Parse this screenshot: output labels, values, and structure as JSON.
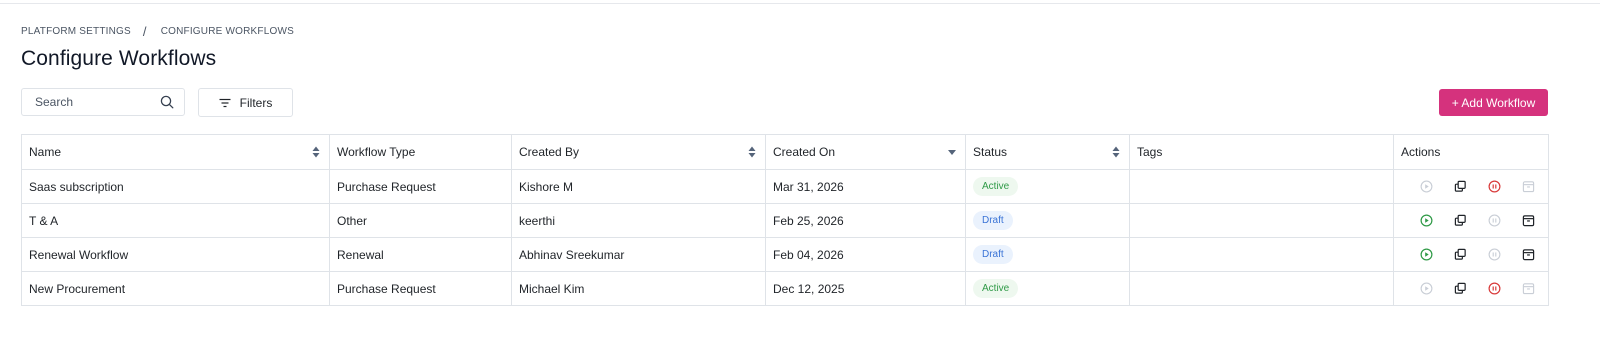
{
  "breadcrumb": {
    "parent": "PLATFORM SETTINGS",
    "separator": "/",
    "current": "CONFIGURE WORKFLOWS"
  },
  "page": {
    "title": "Configure Workflows"
  },
  "toolbar": {
    "search_placeholder": "Search",
    "filters_label": "Filters",
    "add_label": "+ Add Workflow"
  },
  "table": {
    "headers": {
      "name": "Name",
      "type": "Workflow Type",
      "created_by": "Created By",
      "created_on": "Created On",
      "status": "Status",
      "tags": "Tags",
      "actions": "Actions"
    },
    "rows": [
      {
        "name": "Saas subscription",
        "type": "Purchase Request",
        "created_by": "Kishore M",
        "created_on": "Mar 31, 2026",
        "status": "Active",
        "tags": ""
      },
      {
        "name": "T & A",
        "type": "Other",
        "created_by": "keerthi",
        "created_on": "Feb 25, 2026",
        "status": "Draft",
        "tags": ""
      },
      {
        "name": "Renewal Workflow",
        "type": "Renewal",
        "created_by": "Abhinav Sreekumar",
        "created_on": "Feb 04, 2026",
        "status": "Draft",
        "tags": ""
      },
      {
        "name": "New Procurement",
        "type": "Purchase Request",
        "created_by": "Michael Kim",
        "created_on": "Dec 12, 2025",
        "status": "Active",
        "tags": ""
      }
    ]
  },
  "icons": {
    "search": "search-icon",
    "filter": "filter-icon",
    "sort": "sort-icon",
    "sort_desc": "sort-desc-icon",
    "activate": "play-icon",
    "duplicate": "copy-icon",
    "deactivate": "pause-icon",
    "archive": "archive-icon"
  },
  "colors": {
    "primary": "#d5327d",
    "active_text": "#2f9a47",
    "active_bg": "#eef8ef",
    "draft_text": "#3b74d6",
    "draft_bg": "#eaf2fd",
    "play_enabled": "#2f9a47",
    "pause_enabled": "#d93b3b",
    "disabled": "#c9ced6",
    "border": "#dfe3e8"
  }
}
